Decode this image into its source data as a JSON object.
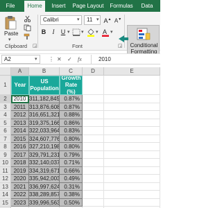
{
  "ribbon": {
    "tabs": [
      "File",
      "Home",
      "Insert",
      "Page Layout",
      "Formulas",
      "Data"
    ],
    "active_tab": "Home",
    "paste_label": "Paste",
    "clipboard_label": "Clipboard",
    "font_label": "Font",
    "font_name": "Calibri",
    "font_size": "11",
    "bold": "B",
    "italic": "I",
    "underline": "U",
    "conditional_formatting_line1": "Conditional",
    "conditional_formatting_line2": "Formatting",
    "brand_color": "#217346",
    "header_fill": "#1aa89a",
    "data_fill": "#bfbfbf"
  },
  "formula_bar": {
    "name_box": "A2",
    "fx": "fx",
    "value": "2010"
  },
  "grid": {
    "columns": [
      "A",
      "B",
      "C",
      "D",
      "E"
    ],
    "rows": [
      "1",
      "2",
      "3",
      "4",
      "5",
      "6",
      "7",
      "8",
      "9",
      "10",
      "11",
      "12",
      "13",
      "14",
      "15",
      "16"
    ],
    "headers": {
      "year": "Year",
      "population": "US Population",
      "growth": "Growth Rate (%)"
    },
    "data": [
      [
        "2010",
        "311,182,845",
        "0.87%"
      ],
      [
        "2011",
        "313,876,608",
        "0.87%"
      ],
      [
        "2012",
        "316,651,321",
        "0.88%"
      ],
      [
        "2013",
        "319,375,166",
        "0.86%"
      ],
      [
        "2014",
        "322,033,964",
        "0.83%"
      ],
      [
        "2015",
        "324,607,776",
        "0.80%"
      ],
      [
        "2016",
        "327,210,198",
        "0.80%"
      ],
      [
        "2017",
        "329,791,231",
        "0.79%"
      ],
      [
        "2018",
        "332,140,037",
        "0.71%"
      ],
      [
        "2019",
        "334,319,671",
        "0.66%"
      ],
      [
        "2020",
        "335,942,003",
        "0.49%"
      ],
      [
        "2021",
        "336,997,624",
        "0.31%"
      ],
      [
        "2022",
        "338,289,857",
        "0.38%"
      ],
      [
        "2023",
        "339,996,563",
        "0.50%"
      ]
    ]
  }
}
